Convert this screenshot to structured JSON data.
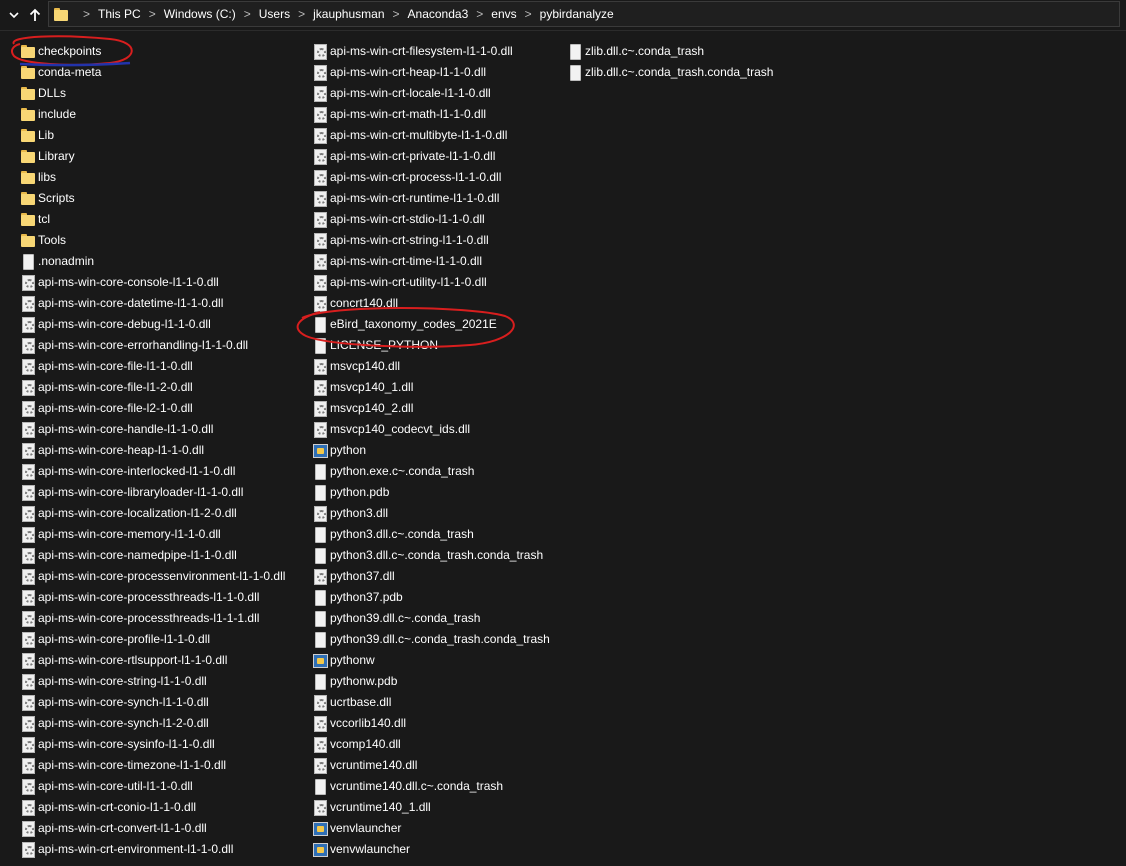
{
  "window": {
    "expand_icon": "chevron-down-icon",
    "up_icon": "up-arrow-icon",
    "address_folder_icon": "folder-icon",
    "breadcrumb": [
      "This PC",
      "Windows (C:)",
      "Users",
      "jkauphusman",
      "Anaconda3",
      "envs",
      "pybirdanalyze"
    ],
    "separator": ">"
  },
  "colors": {
    "background": "#191919",
    "text": "#ffffff",
    "annotation": "#d81e1e",
    "annotation_underline": "#2233aa",
    "folder": "#f8d775"
  },
  "columns": [
    [
      {
        "name": "checkpoints",
        "type": "folder"
      },
      {
        "name": "conda-meta",
        "type": "folder"
      },
      {
        "name": "DLLs",
        "type": "folder"
      },
      {
        "name": "include",
        "type": "folder"
      },
      {
        "name": "Lib",
        "type": "folder"
      },
      {
        "name": "Library",
        "type": "folder"
      },
      {
        "name": "libs",
        "type": "folder"
      },
      {
        "name": "Scripts",
        "type": "folder"
      },
      {
        "name": "tcl",
        "type": "folder"
      },
      {
        "name": "Tools",
        "type": "folder"
      },
      {
        "name": ".nonadmin",
        "type": "file"
      },
      {
        "name": "api-ms-win-core-console-l1-1-0.dll",
        "type": "dll"
      },
      {
        "name": "api-ms-win-core-datetime-l1-1-0.dll",
        "type": "dll"
      },
      {
        "name": "api-ms-win-core-debug-l1-1-0.dll",
        "type": "dll"
      },
      {
        "name": "api-ms-win-core-errorhandling-l1-1-0.dll",
        "type": "dll"
      },
      {
        "name": "api-ms-win-core-file-l1-1-0.dll",
        "type": "dll"
      },
      {
        "name": "api-ms-win-core-file-l1-2-0.dll",
        "type": "dll"
      },
      {
        "name": "api-ms-win-core-file-l2-1-0.dll",
        "type": "dll"
      },
      {
        "name": "api-ms-win-core-handle-l1-1-0.dll",
        "type": "dll"
      },
      {
        "name": "api-ms-win-core-heap-l1-1-0.dll",
        "type": "dll"
      },
      {
        "name": "api-ms-win-core-interlocked-l1-1-0.dll",
        "type": "dll"
      },
      {
        "name": "api-ms-win-core-libraryloader-l1-1-0.dll",
        "type": "dll"
      },
      {
        "name": "api-ms-win-core-localization-l1-2-0.dll",
        "type": "dll"
      },
      {
        "name": "api-ms-win-core-memory-l1-1-0.dll",
        "type": "dll"
      },
      {
        "name": "api-ms-win-core-namedpipe-l1-1-0.dll",
        "type": "dll"
      },
      {
        "name": "api-ms-win-core-processenvironment-l1-1-0.dll",
        "type": "dll"
      },
      {
        "name": "api-ms-win-core-processthreads-l1-1-0.dll",
        "type": "dll"
      },
      {
        "name": "api-ms-win-core-processthreads-l1-1-1.dll",
        "type": "dll"
      },
      {
        "name": "api-ms-win-core-profile-l1-1-0.dll",
        "type": "dll"
      },
      {
        "name": "api-ms-win-core-rtlsupport-l1-1-0.dll",
        "type": "dll"
      },
      {
        "name": "api-ms-win-core-string-l1-1-0.dll",
        "type": "dll"
      },
      {
        "name": "api-ms-win-core-synch-l1-1-0.dll",
        "type": "dll"
      },
      {
        "name": "api-ms-win-core-synch-l1-2-0.dll",
        "type": "dll"
      },
      {
        "name": "api-ms-win-core-sysinfo-l1-1-0.dll",
        "type": "dll"
      },
      {
        "name": "api-ms-win-core-timezone-l1-1-0.dll",
        "type": "dll"
      },
      {
        "name": "api-ms-win-core-util-l1-1-0.dll",
        "type": "dll"
      },
      {
        "name": "api-ms-win-crt-conio-l1-1-0.dll",
        "type": "dll"
      },
      {
        "name": "api-ms-win-crt-convert-l1-1-0.dll",
        "type": "dll"
      },
      {
        "name": "api-ms-win-crt-environment-l1-1-0.dll",
        "type": "dll"
      }
    ],
    [
      {
        "name": "api-ms-win-crt-filesystem-l1-1-0.dll",
        "type": "dll"
      },
      {
        "name": "api-ms-win-crt-heap-l1-1-0.dll",
        "type": "dll"
      },
      {
        "name": "api-ms-win-crt-locale-l1-1-0.dll",
        "type": "dll"
      },
      {
        "name": "api-ms-win-crt-math-l1-1-0.dll",
        "type": "dll"
      },
      {
        "name": "api-ms-win-crt-multibyte-l1-1-0.dll",
        "type": "dll"
      },
      {
        "name": "api-ms-win-crt-private-l1-1-0.dll",
        "type": "dll"
      },
      {
        "name": "api-ms-win-crt-process-l1-1-0.dll",
        "type": "dll"
      },
      {
        "name": "api-ms-win-crt-runtime-l1-1-0.dll",
        "type": "dll"
      },
      {
        "name": "api-ms-win-crt-stdio-l1-1-0.dll",
        "type": "dll"
      },
      {
        "name": "api-ms-win-crt-string-l1-1-0.dll",
        "type": "dll"
      },
      {
        "name": "api-ms-win-crt-time-l1-1-0.dll",
        "type": "dll"
      },
      {
        "name": "api-ms-win-crt-utility-l1-1-0.dll",
        "type": "dll"
      },
      {
        "name": "concrt140.dll",
        "type": "dll"
      },
      {
        "name": "eBird_taxonomy_codes_2021E",
        "type": "file"
      },
      {
        "name": "LICENSE_PYTHON",
        "type": "file"
      },
      {
        "name": "msvcp140.dll",
        "type": "dll"
      },
      {
        "name": "msvcp140_1.dll",
        "type": "dll"
      },
      {
        "name": "msvcp140_2.dll",
        "type": "dll"
      },
      {
        "name": "msvcp140_codecvt_ids.dll",
        "type": "dll"
      },
      {
        "name": "python",
        "type": "exe"
      },
      {
        "name": "python.exe.c~.conda_trash",
        "type": "file"
      },
      {
        "name": "python.pdb",
        "type": "file"
      },
      {
        "name": "python3.dll",
        "type": "dll"
      },
      {
        "name": "python3.dll.c~.conda_trash",
        "type": "file"
      },
      {
        "name": "python3.dll.c~.conda_trash.conda_trash",
        "type": "file"
      },
      {
        "name": "python37.dll",
        "type": "dll"
      },
      {
        "name": "python37.pdb",
        "type": "file"
      },
      {
        "name": "python39.dll.c~.conda_trash",
        "type": "file"
      },
      {
        "name": "python39.dll.c~.conda_trash.conda_trash",
        "type": "file"
      },
      {
        "name": "pythonw",
        "type": "exe"
      },
      {
        "name": "pythonw.pdb",
        "type": "file"
      },
      {
        "name": "ucrtbase.dll",
        "type": "dll"
      },
      {
        "name": "vccorlib140.dll",
        "type": "dll"
      },
      {
        "name": "vcomp140.dll",
        "type": "dll"
      },
      {
        "name": "vcruntime140.dll",
        "type": "dll"
      },
      {
        "name": "vcruntime140.dll.c~.conda_trash",
        "type": "file"
      },
      {
        "name": "vcruntime140_1.dll",
        "type": "dll"
      },
      {
        "name": "venvlauncher",
        "type": "exe"
      },
      {
        "name": "venvwlauncher",
        "type": "exe"
      }
    ],
    [
      {
        "name": "zlib.dll.c~.conda_trash",
        "type": "file"
      },
      {
        "name": "zlib.dll.c~.conda_trash.conda_trash",
        "type": "file"
      }
    ]
  ]
}
